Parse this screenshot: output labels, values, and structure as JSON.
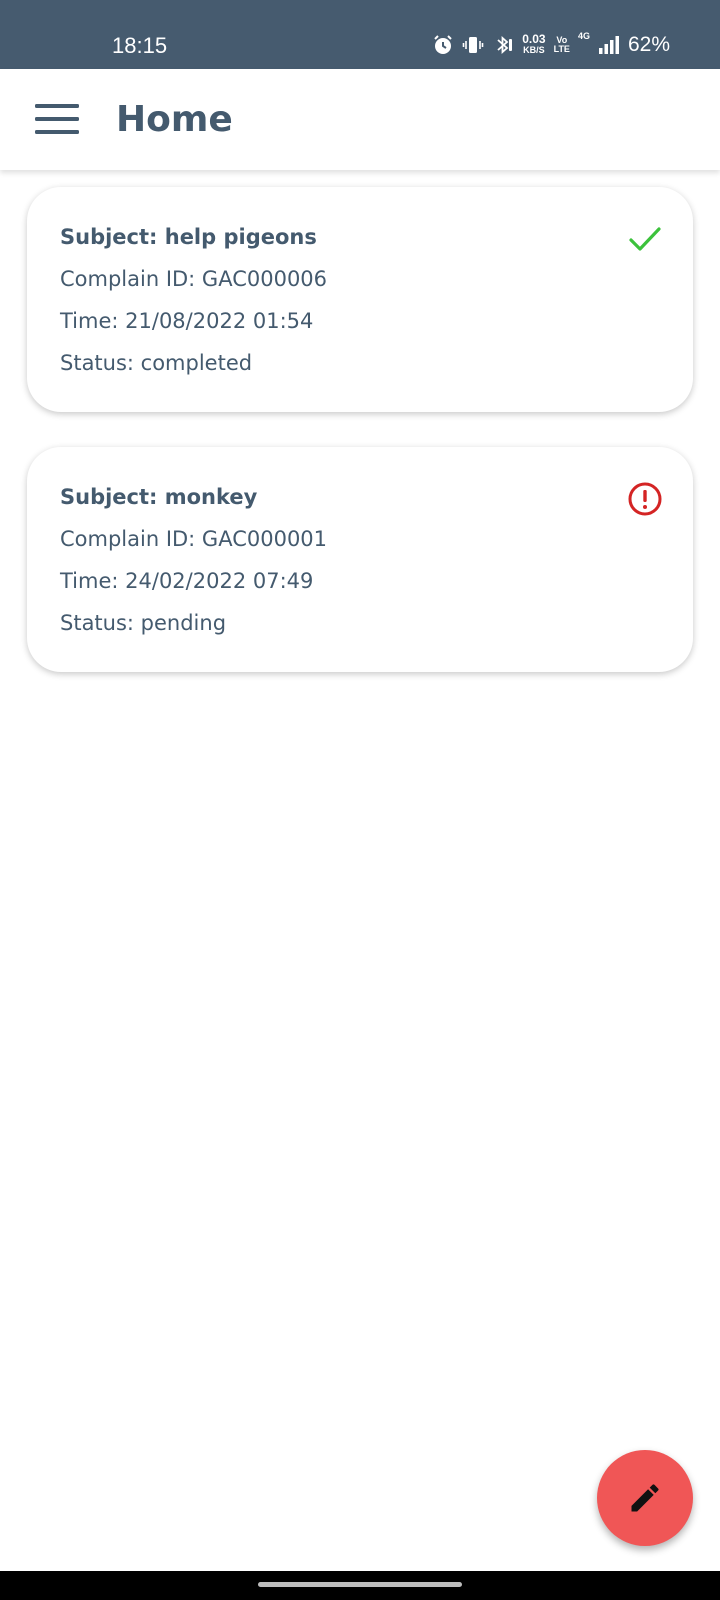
{
  "status_bar": {
    "time": "18:15",
    "net_speed_value": "0.03",
    "net_speed_unit": "KB/S",
    "volte_top": "Vo",
    "volte_bottom": "LTE",
    "network_type": "4G",
    "battery": "62%",
    "icons": [
      "alarm-icon",
      "vibrate-icon",
      "bluetooth-icon",
      "signal-icon"
    ]
  },
  "app_bar": {
    "title": "Home",
    "menu_icon": "hamburger-menu-icon"
  },
  "complaints": [
    {
      "subject": "Subject: help pigeons",
      "complain_id": "Complain ID: GAC000006",
      "time": "Time: 21/08/2022 01:54",
      "status": "Status: completed",
      "status_icon": "checkmark-icon",
      "status_color": "#3cc23c"
    },
    {
      "subject": "Subject: monkey",
      "complain_id": "Complain ID: GAC000001",
      "time": "Time: 24/02/2022 07:49",
      "status": "Status: pending",
      "status_icon": "alert-circle-icon",
      "status_color": "#d42424"
    }
  ],
  "fab": {
    "icon": "pencil-icon",
    "color": "#f05656"
  },
  "colors": {
    "status_bar_bg": "#465b6f",
    "text_primary": "#445a6e"
  }
}
